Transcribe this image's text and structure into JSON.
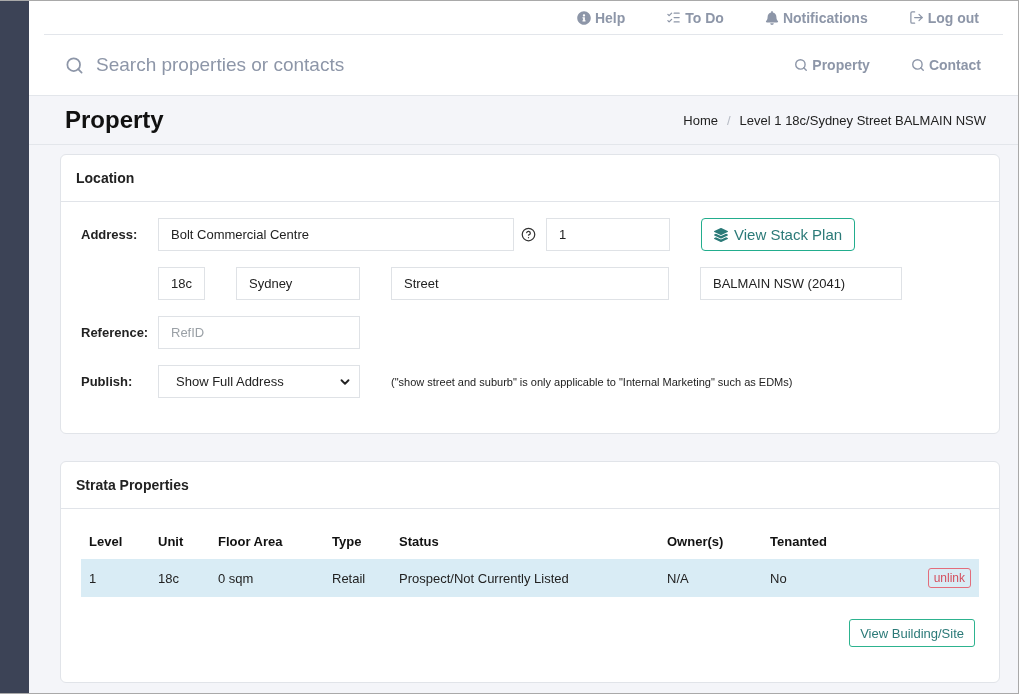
{
  "top_nav": {
    "links": [
      "Help",
      "To Do",
      "Notifications",
      "Log out"
    ]
  },
  "search": {
    "placeholder": "Search properties or contacts",
    "scopes": [
      "Property",
      "Contact"
    ]
  },
  "page_header": {
    "title": "Property",
    "breadcrumb": {
      "items": [
        "Home",
        "Level 1 18c/Sydney Street BALMAIN NSW"
      ],
      "separator": "/"
    }
  },
  "location": {
    "title": "Location",
    "address": {
      "label": "Address:",
      "fields": [
        "Bolt Commercial Centre",
        "1",
        "18c",
        "Sydney",
        "Street",
        "BALMAIN NSW (2041)"
      ]
    },
    "stack_plan_button": "View Stack Plan",
    "reference": {
      "label": "Reference:",
      "placeholder": "RefID"
    },
    "publish": {
      "label": "Publish:",
      "value": "Show Full Address",
      "note": "(\"show street and suburb\" is only applicable to \"Internal Marketing\" such as EDMs)"
    }
  },
  "strata": {
    "title": "Strata Properties",
    "columns": [
      "Level",
      "Unit",
      "Floor Area",
      "Type",
      "Status",
      "Owner(s)",
      "Tenanted"
    ],
    "rows": [
      {
        "cells": [
          "1",
          "18c",
          "0 sqm",
          "Retail",
          "Prospect/Not Currently Listed",
          "N/A",
          "No"
        ],
        "highlighted": true,
        "action": "unlink"
      }
    ],
    "footer_button": "View Building/Site"
  }
}
